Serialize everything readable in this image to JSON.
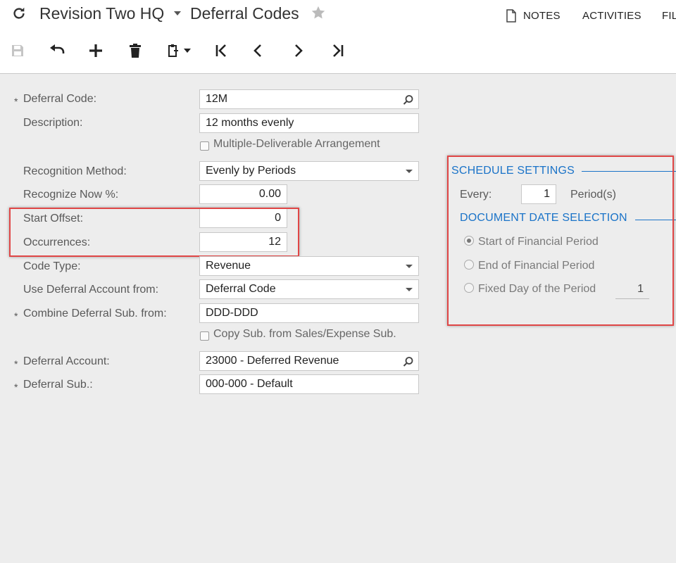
{
  "header": {
    "company": "Revision Two HQ",
    "screen": "Deferral Codes",
    "links": {
      "notes": "NOTES",
      "activities": "ACTIVITIES",
      "files": "FIL"
    }
  },
  "form": {
    "deferral_code": {
      "label": "Deferral Code:",
      "value": "12M"
    },
    "description": {
      "label": "Description:",
      "value": "12 months evenly"
    },
    "multiple_deliverable": {
      "label": "Multiple-Deliverable Arrangement"
    },
    "recognition_method": {
      "label": "Recognition Method:",
      "value": "Evenly by Periods"
    },
    "recognize_now": {
      "label": "Recognize Now %:",
      "value": "0.00"
    },
    "start_offset": {
      "label": "Start Offset:",
      "value": "0"
    },
    "occurrences": {
      "label": "Occurrences:",
      "value": "12"
    },
    "code_type": {
      "label": "Code Type:",
      "value": "Revenue"
    },
    "use_deferral_account": {
      "label": "Use Deferral Account from:",
      "value": "Deferral Code"
    },
    "combine_sub": {
      "label": "Combine Deferral Sub. from:",
      "value": "DDD-DDD"
    },
    "copy_sub": {
      "label": "Copy Sub. from Sales/Expense Sub."
    },
    "deferral_account": {
      "label": "Deferral Account:",
      "value": "23000 - Deferred Revenue"
    },
    "deferral_sub": {
      "label": "Deferral Sub.:",
      "value": "000-000 - Default"
    }
  },
  "schedule": {
    "title": "SCHEDULE SETTINGS",
    "every_label": "Every:",
    "every_value": "1",
    "period_label": "Period(s)",
    "doc_title": "DOCUMENT DATE SELECTION",
    "options": [
      "Start of Financial Period",
      "End of Financial Period",
      "Fixed Day of the Period"
    ],
    "fixed_day": "1"
  },
  "colors": {
    "accent": "#1a73c8",
    "highlight": "#e04646"
  }
}
